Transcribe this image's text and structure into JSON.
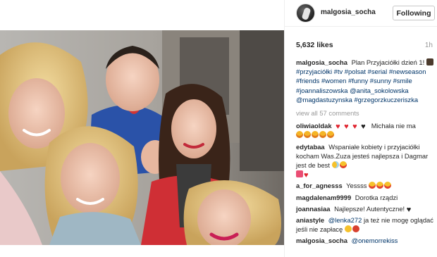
{
  "header": {
    "username": "malgosia_socha",
    "follow_label": "Following"
  },
  "post": {
    "likes": "5,632 likes",
    "time": "1h",
    "caption_user": "malgosia_socha",
    "caption_text": "Plan Przyjaciółki dzień 1!",
    "caption_tags": "#przyjaciółki #tv #polsat #serial #newseason #friends #women #funny #sunny #smile #joannaliszowska @anita_sokolowska @magdastuzynska #grzegorzkuczeriszka",
    "view_all": "view all 57 comments"
  },
  "comments": [
    {
      "user": "oliwiaoldak",
      "text": "Michała nie ma"
    },
    {
      "user": "edytabaa",
      "text": "Wspaniałe kobiety i przyjaciółki kocham Was.Zuza jesteś najlepsza i Dagmar jest de best"
    },
    {
      "user": "a_for_agnesss",
      "text": "Yessss"
    },
    {
      "user": "magdalenam9999",
      "text": "Dorotka rządzi"
    },
    {
      "user": "joannasiaa",
      "text": "Najlepsze! Autentyczne!"
    },
    {
      "user": "aniastyle",
      "text_tag": "@lenka272",
      "text": "ja też nie mogę oglądać jeśli nie zapłacę"
    },
    {
      "user": "malgosia_socha",
      "text_tag": "@onemorrekiss",
      "text": ""
    }
  ],
  "icons": {
    "heart": "heart-icon",
    "emoji": "emoji-icon",
    "photo": "group-selfie-photo"
  },
  "colors": {
    "link": "#003569",
    "muted": "#999999",
    "border": "#efefef"
  }
}
